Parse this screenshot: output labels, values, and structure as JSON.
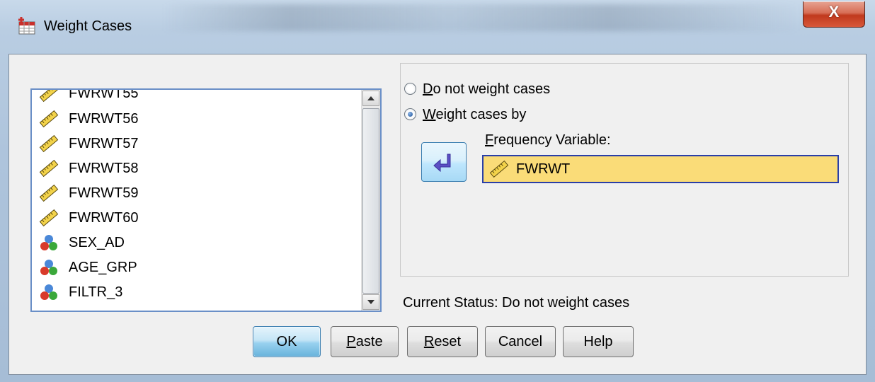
{
  "window": {
    "title": "Weight Cases",
    "close_label": "X"
  },
  "variables": [
    {
      "name": "FWRWT55",
      "type": "scale-icon"
    },
    {
      "name": "FWRWT56",
      "type": "scale-icon"
    },
    {
      "name": "FWRWT57",
      "type": "scale-icon"
    },
    {
      "name": "FWRWT58",
      "type": "scale-icon"
    },
    {
      "name": "FWRWT59",
      "type": "scale-icon"
    },
    {
      "name": "FWRWT60",
      "type": "scale-icon"
    },
    {
      "name": "SEX_AD",
      "type": "nominal-icon"
    },
    {
      "name": "AGE_GRP",
      "type": "nominal-icon"
    },
    {
      "name": "FILTR_3",
      "type": "nominal-icon"
    }
  ],
  "weighting": {
    "option_none_rest": "o not weight cases",
    "option_none_key": "D",
    "option_by_rest": "eight cases by",
    "option_by_key": "W",
    "selected": "Weight cases by",
    "freq_label_key": "F",
    "freq_label_rest": "requency Variable:",
    "freq_value": "FWRWT"
  },
  "status": "Current Status: Do not weight cases",
  "buttons": {
    "ok": "OK",
    "paste_key": "P",
    "paste_rest": "aste",
    "reset_key": "R",
    "reset_rest": "eset",
    "cancel": "Cancel",
    "help": "Help"
  },
  "colors": {
    "selection_fill": "#fadc78",
    "selection_border": "#2a3fa8",
    "list_border": "#6a8fc7",
    "move_arrow": "#5b4fc4"
  }
}
